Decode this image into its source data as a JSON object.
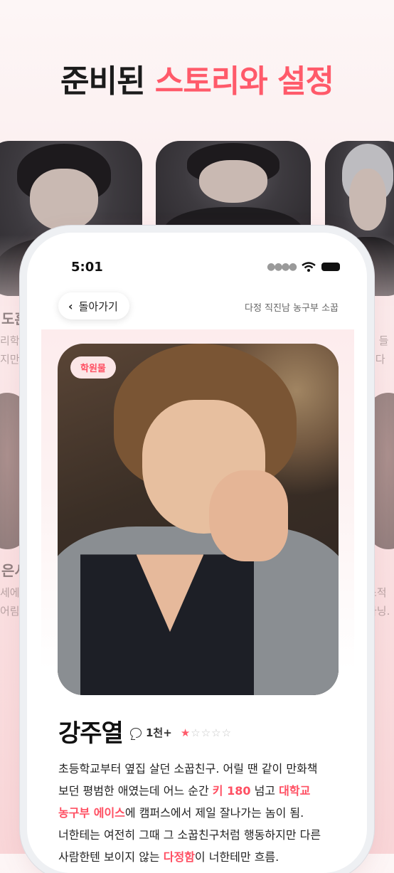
{
  "headline": {
    "prefix": "준비된",
    "accent": "스토리와 설정"
  },
  "side_cards": {
    "left_name": "도훈",
    "left_lines": [
      "리학교",
      "지만 A"
    ],
    "left_name_2": "은서",
    "left_lines_2": [
      "세에서",
      "어림."
    ],
    "right_lines": [
      "로 들",
      "체다"
    ],
    "right_lines_2": [
      "소적",
      "타닝."
    ]
  },
  "status": {
    "time": "5:01",
    "signal_icon": "wifi-icon",
    "battery_icon": "battery-icon"
  },
  "nav": {
    "back_label": "돌아가기",
    "tags": "다정 직진남 농구부 소꿉"
  },
  "character": {
    "badge": "학원물",
    "name": "강주열",
    "chat_count": "1천+",
    "rating_filled": 1,
    "rating_total": 5,
    "description": {
      "p1": "초등학교부터 옆집 살던 소꿉친구. 어릴 땐 같이 만화책 보던 평범한 애였는데 어느 순간 ",
      "h1": "키 180",
      "p2": " 넘고 ",
      "h2": "대학교 농구부 에이스",
      "p3": "에 캠퍼스에서 제일 잘나가는 놈이 됨. 너한테는 여전히 그때 그 소꿉친구처럼 행동하지만 다른 사람한텐 보이지 않는 ",
      "h3": "다정함",
      "p4": "이 너한테만 흐름."
    }
  },
  "colors": {
    "accent": "#ff5a6a",
    "badge_bg": "#fbe6e7"
  }
}
